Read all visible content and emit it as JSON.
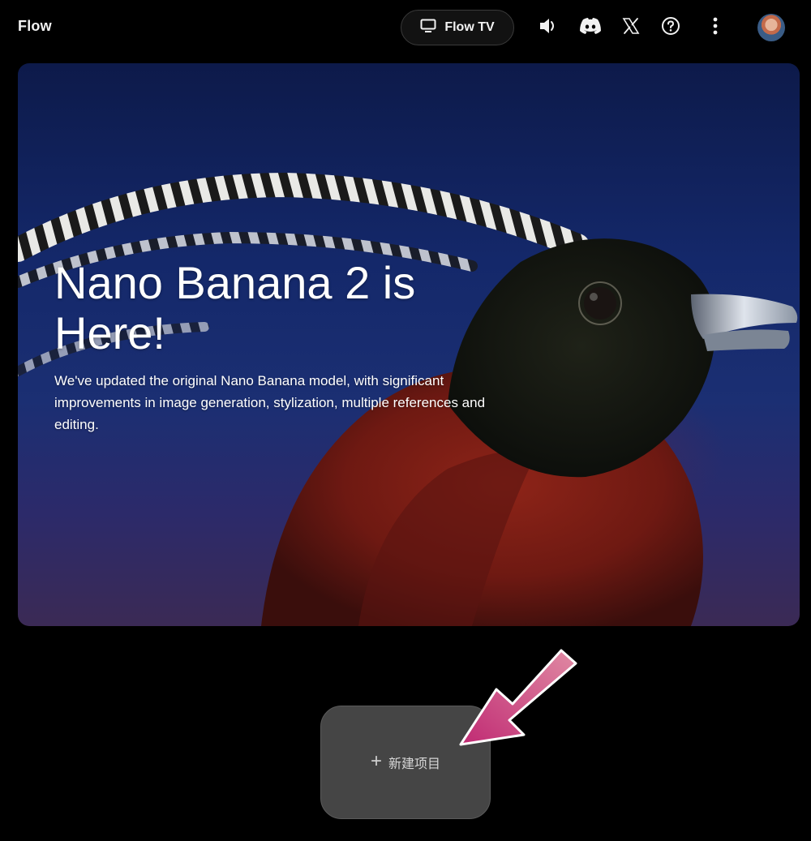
{
  "header": {
    "app_title": "Flow",
    "flow_tv_label": "Flow TV",
    "icons": [
      "tv-icon",
      "volume-icon",
      "discord-icon",
      "x-icon",
      "help-icon",
      "more-vert-icon",
      "avatar"
    ]
  },
  "hero": {
    "title": "Nano Banana 2 is Here!",
    "description": "We've updated the original Nano Banana model, with significant improvements in image generation, stylization, multiple references and editing."
  },
  "new_project": {
    "plus": "+",
    "label": "新建项目"
  },
  "colors": {
    "background": "#000000",
    "button_gray": "#454545",
    "arrow_pink": "#c2357a",
    "hero_blue": "#14286a",
    "bird_red": "#7a1a14"
  }
}
